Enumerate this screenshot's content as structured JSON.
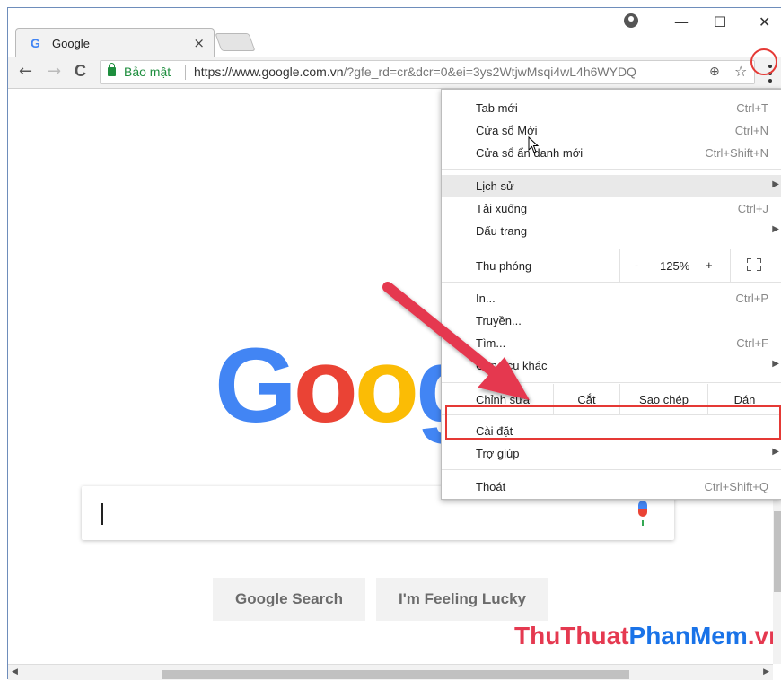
{
  "tab": {
    "title": "Google",
    "favicon": "google-g-icon",
    "close_glyph": "×"
  },
  "window_controls": {
    "minimize": "—",
    "maximize": "☐",
    "close": "✕"
  },
  "toolbar": {
    "back": "←",
    "forward": "→",
    "reload": "C",
    "secure_label": "Bảo mật",
    "url_host": "https://www.google.com.vn",
    "url_rest": "/?gfe_rd=cr&dcr=0&ei=3ys2WtjwMsqi4wL4h6WYDQ",
    "zoom_icon": "⊕",
    "star_icon": "☆"
  },
  "page": {
    "logo": [
      "G",
      "o",
      "o",
      "g"
    ],
    "google_search": "Google Search",
    "feeling_lucky": "I'm Feeling Lucky",
    "watermark_a": "ThuThuat",
    "watermark_b": "PhanMem",
    "watermark_c": ".vn"
  },
  "menu": {
    "new_tab": {
      "label": "Tab mới",
      "shortcut": "Ctrl+T"
    },
    "new_window": {
      "label": "Cửa sổ Mới",
      "shortcut": "Ctrl+N"
    },
    "incognito": {
      "label": "Cửa sổ ẩn danh mới",
      "shortcut": "Ctrl+Shift+N"
    },
    "history": {
      "label": "Lịch sử"
    },
    "downloads": {
      "label": "Tải xuống",
      "shortcut": "Ctrl+J"
    },
    "bookmarks": {
      "label": "Dấu trang"
    },
    "zoom": {
      "label": "Thu phóng",
      "minus": "-",
      "value": "125%",
      "plus": "+"
    },
    "print": {
      "label": "In...",
      "shortcut": "Ctrl+P"
    },
    "cast": {
      "label": "Truyền..."
    },
    "find": {
      "label": "Tìm...",
      "shortcut": "Ctrl+F"
    },
    "more_tools": {
      "label": "Công cụ khác"
    },
    "edit": {
      "label": "Chỉnh sửa",
      "cut": "Cắt",
      "copy": "Sao chép",
      "paste": "Dán"
    },
    "settings": {
      "label": "Cài đặt"
    },
    "help": {
      "label": "Trợ giúp"
    },
    "exit": {
      "label": "Thoát",
      "shortcut": "Ctrl+Shift+Q"
    },
    "submenu_arrow": "▶"
  },
  "colors": {
    "accent_red": "#e53935",
    "google_blue": "#4285f4",
    "google_red": "#ea4335",
    "google_yellow": "#fbbc05"
  }
}
